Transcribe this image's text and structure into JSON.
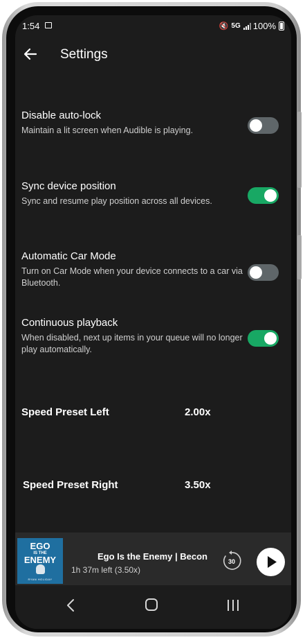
{
  "status_bar": {
    "time": "1:54",
    "network": "5G",
    "battery": "100%"
  },
  "header": {
    "title": "Settings"
  },
  "settings": [
    {
      "label": "Disable auto-lock",
      "description": "Maintain a lit screen when Audible is playing.",
      "enabled": false
    },
    {
      "label": "Sync device position",
      "description": "Sync and resume play position across all devices.",
      "enabled": true
    },
    {
      "label": "Automatic Car Mode",
      "description": "Turn on Car Mode when your device connects to a car via Bluetooth.",
      "enabled": false
    },
    {
      "label": "Continuous playback",
      "description": "When disabled, next up items in your queue will no longer play automatically.",
      "enabled": true
    }
  ],
  "speed_presets": {
    "left": {
      "label": "Speed Preset Left",
      "value": "2.00x"
    },
    "right": {
      "label": "Speed Preset Right",
      "value": "3.50x"
    }
  },
  "mini_player": {
    "title": "Ego Is the Enemy | Becon",
    "time_left": "1h 37m left (3.50x)",
    "rewind_seconds": "30",
    "cover": {
      "title_top": "EGO",
      "title_small": "IS THE",
      "title_bottom": "ENEMY",
      "author": "RYAN HOLIDAY"
    }
  },
  "colors": {
    "background": "#1c1c1c",
    "toggle_on": "#18a864",
    "toggle_off": "#5f6669",
    "player_bar": "#2a2a2a"
  }
}
